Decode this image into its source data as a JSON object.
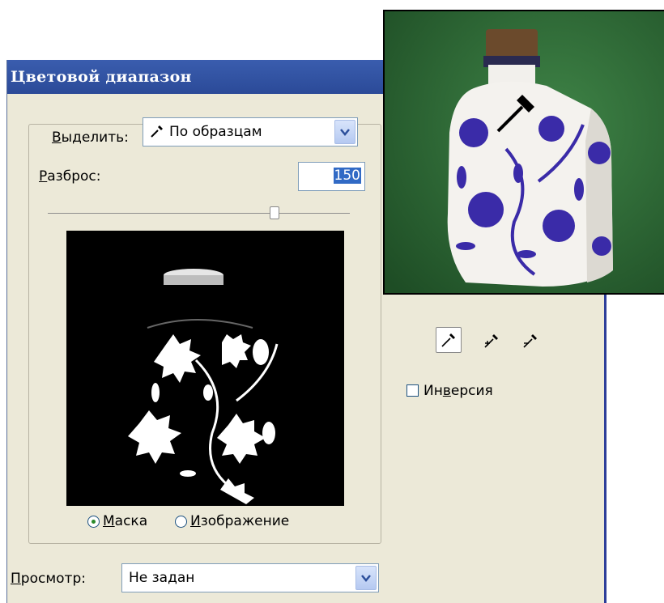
{
  "dialog": {
    "title": "Цветовой диапазон"
  },
  "select": {
    "label_u": "В",
    "label_rest": "ыделить:",
    "value": "По образцам"
  },
  "fuzziness": {
    "label_u": "Р",
    "label_rest": "азброс:",
    "value": "150",
    "level": 0.75
  },
  "preview_mode": {
    "mask_u": "М",
    "mask_rest": "аска",
    "image_u": "И",
    "image_rest": "зображение",
    "selected": "mask"
  },
  "invert": {
    "pre": "Ин",
    "u": "в",
    "rest": "ерсия",
    "checked": false
  },
  "display": {
    "label_u": "П",
    "label_rest": "росмотр:",
    "value": "Не задан"
  },
  "icons": {
    "eyedropper": "eyedropper-icon",
    "eyedropper_add": "eyedropper-plus-icon",
    "eyedropper_subtract": "eyedropper-minus-icon",
    "dropdown": "chevron-down-icon"
  },
  "colors": {
    "title_bar": "#2b4a98",
    "dialog_bg": "#ece9d8",
    "selection": "#316ac5",
    "photo_bg": "#2e6a36",
    "pattern": "#3a2ba8"
  }
}
